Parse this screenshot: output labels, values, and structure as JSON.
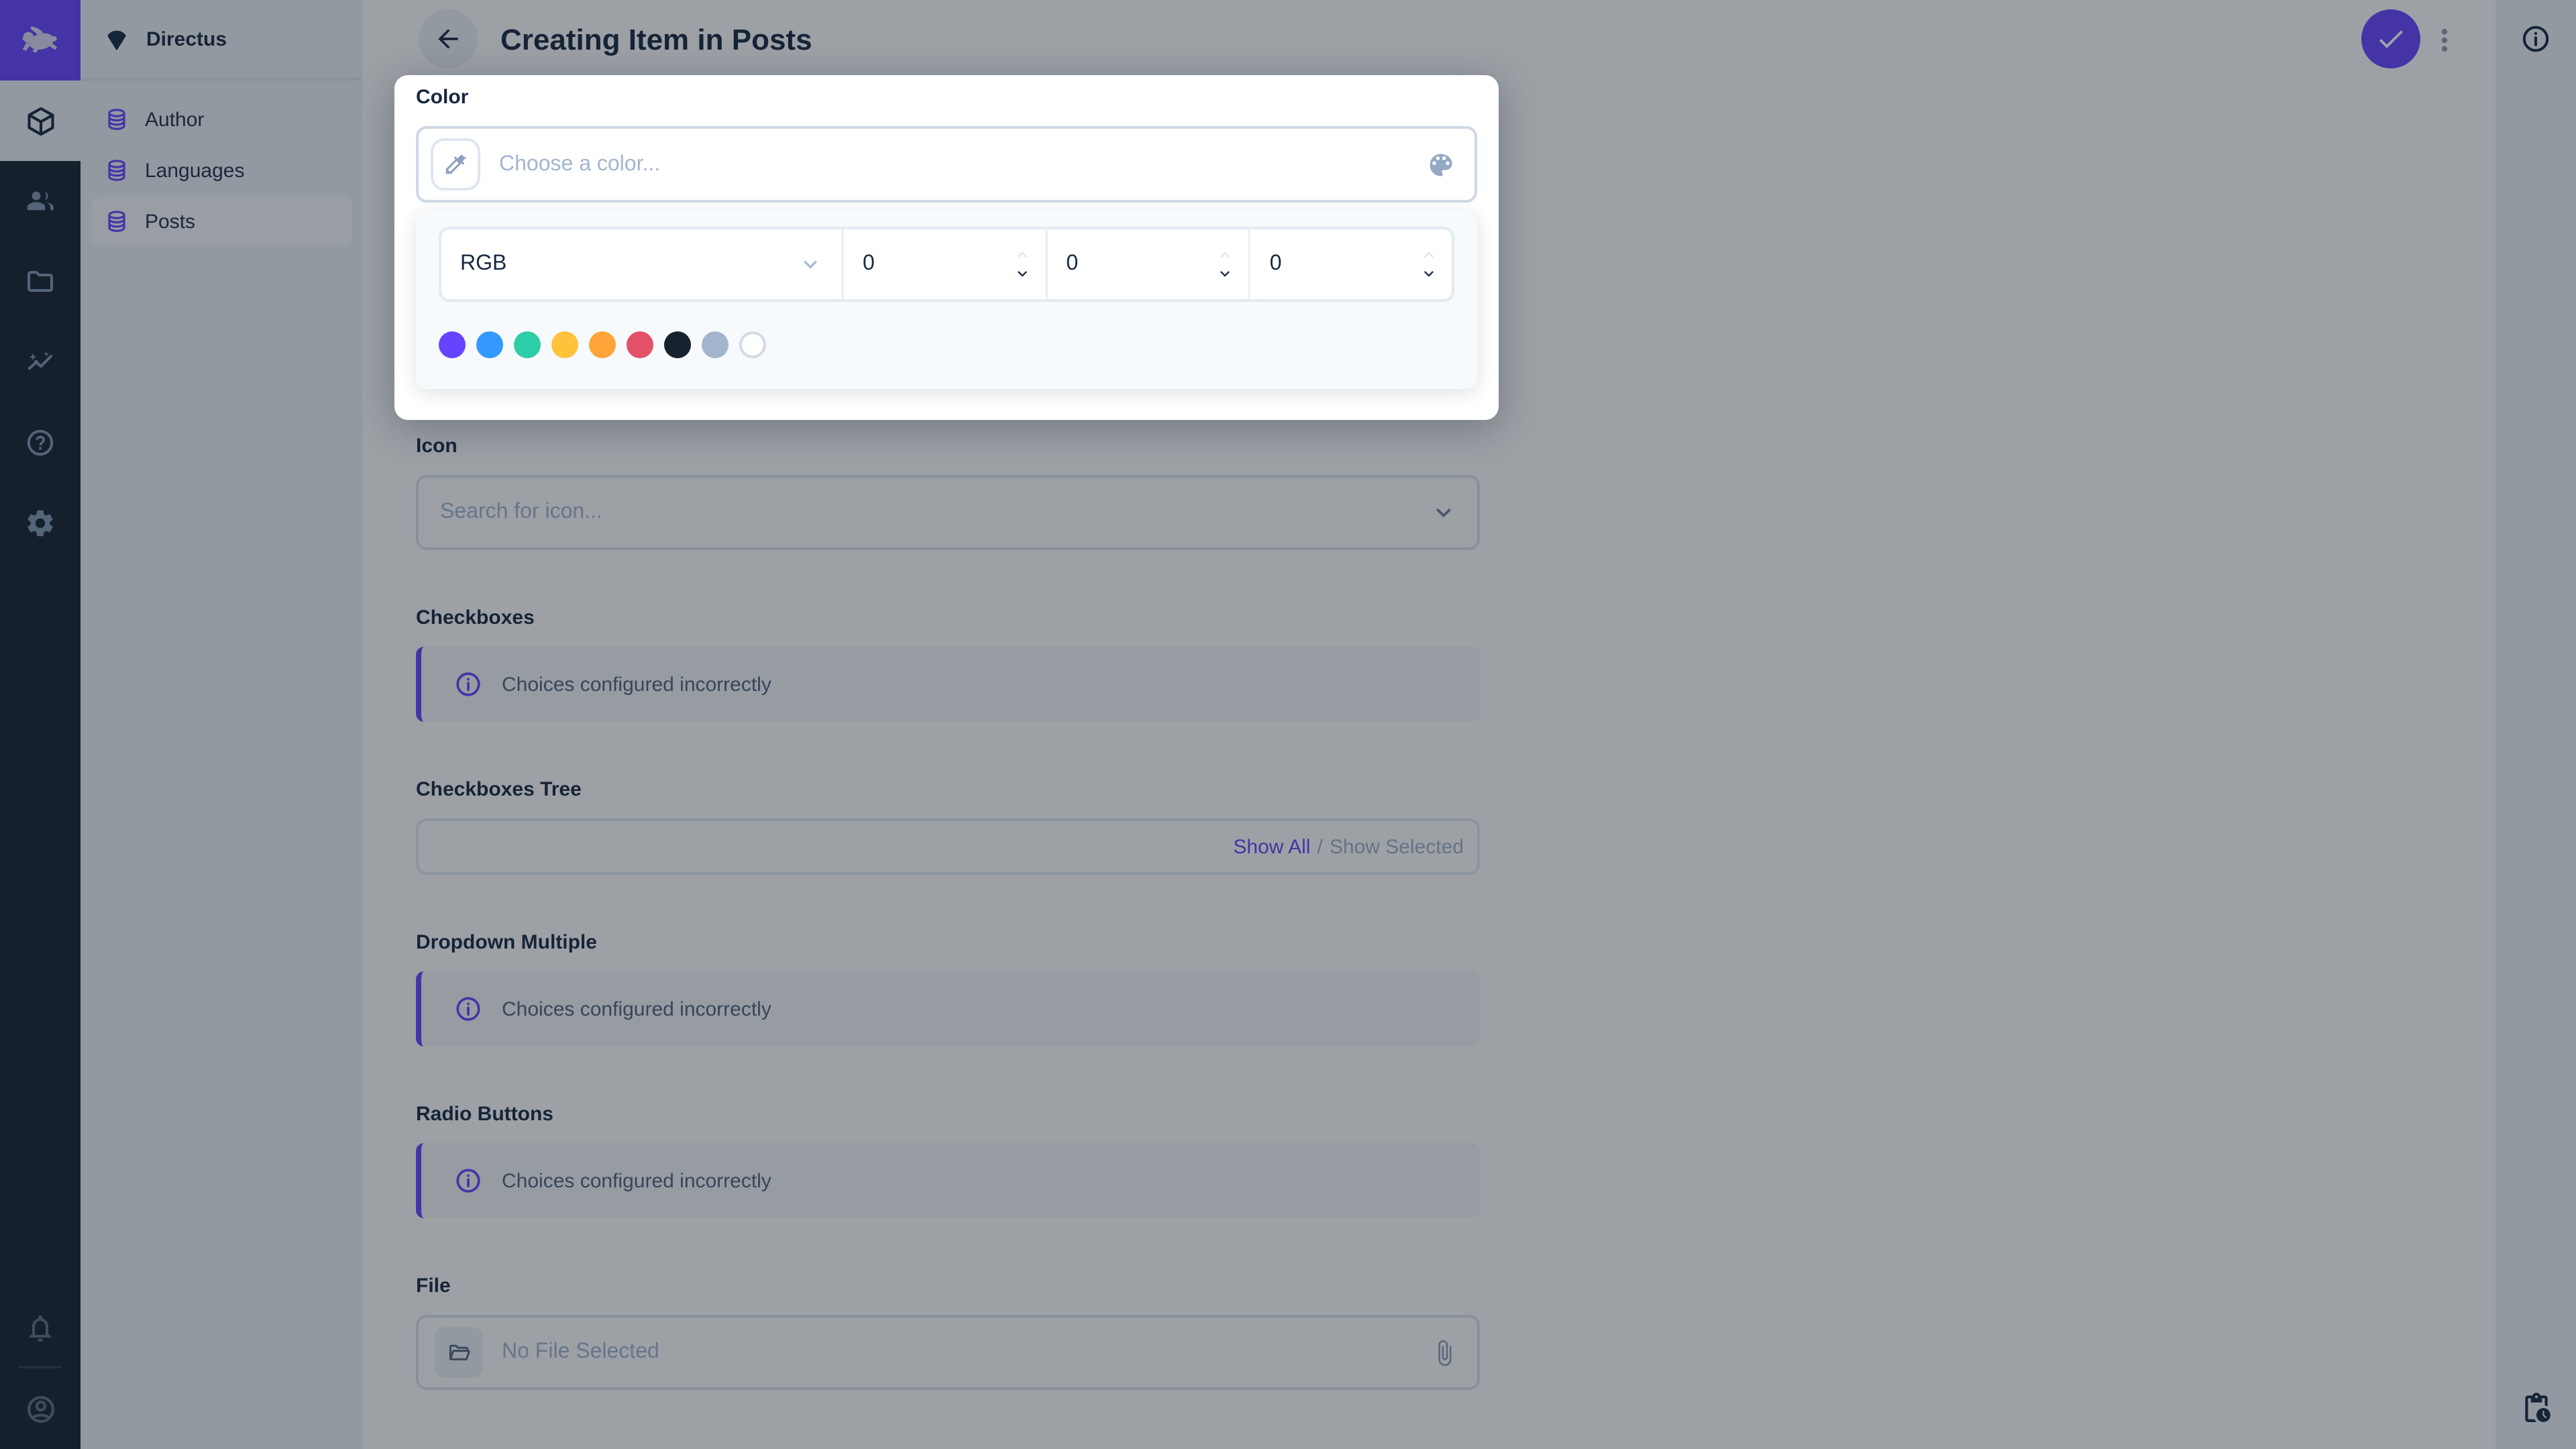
{
  "theme": {
    "accent": "#6644FF",
    "module_bar_bg": "#18222F",
    "sidebar_bg": "#EEF2F7",
    "text_dark": "#172940"
  },
  "module_bar": {
    "logo_icon": "directus-rabbit-logo",
    "modules": [
      "content-box-icon",
      "user-directory-icon",
      "file-library-icon",
      "insights-icon",
      "help-icon",
      "settings-icon"
    ],
    "bottom": [
      "notifications-bell-icon",
      "account-icon"
    ]
  },
  "nav": {
    "project_name": "Directus",
    "project_icon": "fan-icon",
    "items": [
      {
        "label": "Author",
        "icon": "database-icon",
        "active": false
      },
      {
        "label": "Languages",
        "icon": "database-icon",
        "active": false
      },
      {
        "label": "Posts",
        "icon": "database-icon",
        "active": true
      }
    ]
  },
  "header": {
    "title": "Creating Item in Posts",
    "back_icon": "arrow-left-icon",
    "save_icon": "check-icon",
    "more_icon": "more-vertical-icon",
    "info_icon": "info-icon"
  },
  "right_sidebar": {
    "top_icon": "info-icon",
    "bottom_icon": "pending-actions-icon"
  },
  "color_popup": {
    "label": "Color",
    "input_placeholder": "Choose a color...",
    "eyedropper_icon": "eyedropper-icon",
    "palette_icon": "palette-icon",
    "mode_selected": "RGB",
    "channels": [
      "0",
      "0",
      "0"
    ],
    "swatches": [
      "#6644FF",
      "#3399FF",
      "#2ECDA7",
      "#FFC23B",
      "#FFA439",
      "#E35169",
      "#18222F",
      "#A2B5CD",
      "#FFFFFF"
    ]
  },
  "form": {
    "icon": {
      "label": "Icon",
      "placeholder": "Search for icon..."
    },
    "checkboxes": {
      "label": "Checkboxes",
      "notice": "Choices configured incorrectly"
    },
    "checkboxes_tree": {
      "label": "Checkboxes Tree",
      "show_all": "Show All",
      "separator": "/",
      "show_selected": "Show Selected"
    },
    "dropdown_multiple": {
      "label": "Dropdown Multiple",
      "notice": "Choices configured incorrectly"
    },
    "radio_buttons": {
      "label": "Radio Buttons",
      "notice": "Choices configured incorrectly"
    },
    "file": {
      "label": "File",
      "placeholder": "No File Selected",
      "folder_icon": "folder-open-icon",
      "attach_icon": "paperclip-icon"
    }
  },
  "status_icon": "pending-actions-icon"
}
